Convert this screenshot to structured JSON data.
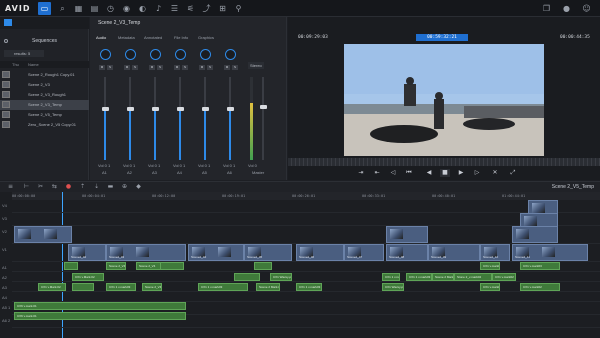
{
  "app": {
    "logo": "AVID"
  },
  "topbar": {
    "icons": [
      "folder-icon",
      "search-icon",
      "grid-icon",
      "media-icon",
      "clock-icon",
      "eye-icon",
      "color-icon",
      "audio-icon",
      "list-icon",
      "mixer-icon",
      "share-icon",
      "apps-icon",
      "bell-icon",
      "layout-icon",
      "mic-icon",
      "user-icon"
    ]
  },
  "bin": {
    "breadcrumb": "Sequences",
    "search_placeholder": "results: 5",
    "columns": [
      "Thu",
      "Name"
    ],
    "rows": [
      "Scene 2_Rough1 Copy.01",
      "Scene 2_V3",
      "Scene 2_V3_Rough1",
      "Scene 2_V3_Temp",
      "Scene 2_V5_Temp",
      "Zero_Scene 2_V5 Copy.01"
    ],
    "selected_index": 3
  },
  "mixer": {
    "tabs": [
      "Audio",
      "Metadata",
      "Annotated",
      "File Info",
      "Graphics"
    ],
    "active_tab": 0,
    "preset_label": "Stereo",
    "channels": [
      {
        "vol": "0",
        "pan": "1",
        "name": "A1",
        "level": 0.62
      },
      {
        "vol": "0",
        "pan": "1",
        "name": "A2",
        "level": 0.62
      },
      {
        "vol": "0",
        "pan": "1",
        "name": "A3",
        "level": 0.62
      },
      {
        "vol": "0",
        "pan": "1",
        "name": "A4",
        "level": 0.62
      },
      {
        "vol": "0",
        "pan": "1",
        "name": "A5",
        "level": 0.62
      },
      {
        "vol": "0",
        "pan": "1",
        "name": "A6",
        "level": 0.62
      }
    ],
    "master": {
      "vol": "0",
      "name": "Master",
      "level": 0.62
    }
  },
  "monitor": {
    "title": "Scene 2_V3_Temp",
    "tc_left": "00:09:29:03",
    "tc_center": "00:59:32:21",
    "tc_right": "00:00:44:35",
    "controls": [
      "mark-in-icon",
      "mark-out-icon",
      "step-back-icon",
      "rewind-icon",
      "play-icon",
      "stop-icon",
      "forward-icon",
      "step-fwd-icon",
      "clear-icon",
      "fullscreen-icon"
    ]
  },
  "timeline": {
    "sequence_name": "Scene 2_V5_Temp",
    "ruler": [
      "00:00:00:00",
      "00:00:04:01",
      "00:00:12:00",
      "00:00:19:01",
      "00:00:26:01",
      "00:00:33:01",
      "00:00:40:01",
      "01:00:44:01"
    ],
    "tracks": [
      "V4",
      "V3",
      "V2",
      "V1",
      "A1",
      "A2",
      "A3",
      "A4",
      "A5 1",
      "A6 2"
    ],
    "vclips_v1": [
      "Scene2_02",
      "Scene2_03",
      "Scene2_04",
      "Scene2_05",
      "Scene2_06",
      "Scene2_07",
      "Scene2_08",
      "Scene2_09",
      "Scene2_10",
      "Scene2_11"
    ],
    "aclips": [
      "CX1 v.Mark.02",
      "CX1 Wavsy-pol",
      "Scene 2_V4",
      "CX1 1 v.mark03",
      "CX1 1 v.mark03",
      "Scene 2 Mark.03",
      "CX1 v.mark02",
      "Stone 2_v.mark02",
      "CX1 Wavsy-pol",
      "CX1 v.mark03"
    ],
    "aclips_long": [
      "CX6 v.mark.01",
      "CX6 v.mark.01"
    ]
  }
}
